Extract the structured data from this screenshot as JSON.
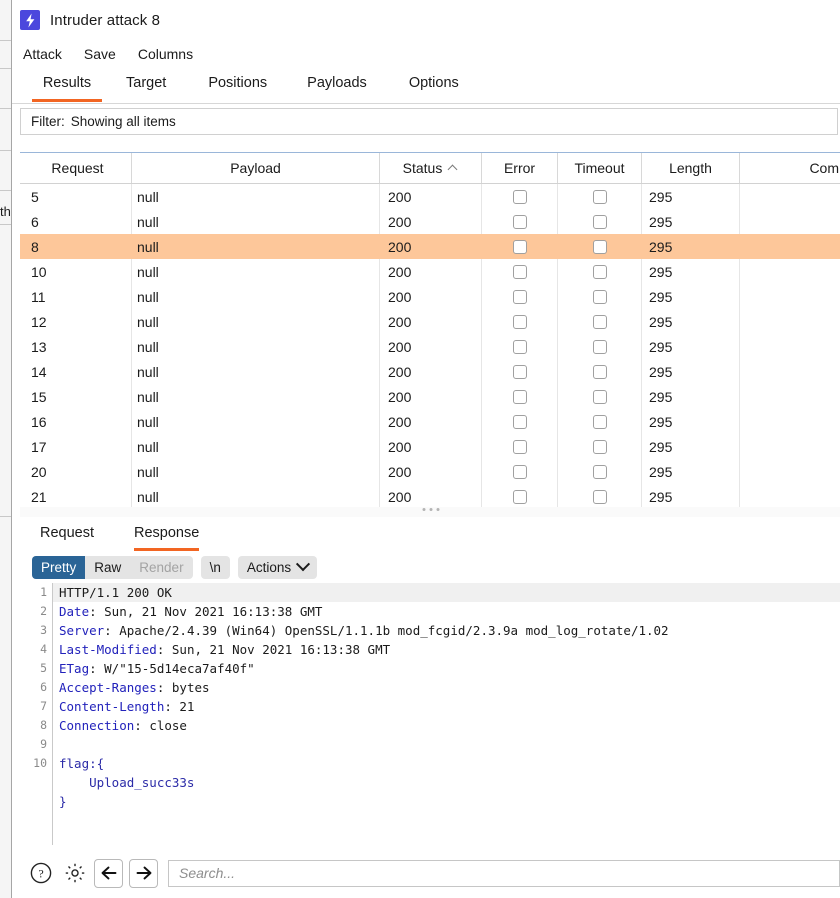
{
  "background_window": {
    "text_fragment": "th"
  },
  "window": {
    "title": "Intruder attack 8",
    "icon": "burp-lightning-icon"
  },
  "menubar": {
    "items": [
      "Attack",
      "Save",
      "Columns"
    ]
  },
  "tabs": {
    "items": [
      {
        "label": "Results",
        "active": true
      },
      {
        "label": "Target",
        "active": false
      },
      {
        "label": "Positions",
        "active": false
      },
      {
        "label": "Payloads",
        "active": false
      },
      {
        "label": "Options",
        "active": false
      }
    ]
  },
  "filter": {
    "label": "Filter:",
    "value": "Showing all items"
  },
  "results_table": {
    "columns": [
      {
        "key": "request",
        "label": "Request",
        "sort": ""
      },
      {
        "key": "payload",
        "label": "Payload",
        "sort": ""
      },
      {
        "key": "status",
        "label": "Status",
        "sort": "asc"
      },
      {
        "key": "error",
        "label": "Error",
        "sort": ""
      },
      {
        "key": "timeout",
        "label": "Timeout",
        "sort": ""
      },
      {
        "key": "length",
        "label": "Length",
        "sort": ""
      },
      {
        "key": "comment",
        "label": "Com",
        "sort": ""
      }
    ],
    "rows": [
      {
        "request": "5",
        "payload": "null",
        "status": "200",
        "error": false,
        "timeout": false,
        "length": "295",
        "comment": "",
        "selected": false
      },
      {
        "request": "6",
        "payload": "null",
        "status": "200",
        "error": false,
        "timeout": false,
        "length": "295",
        "comment": "",
        "selected": false
      },
      {
        "request": "8",
        "payload": "null",
        "status": "200",
        "error": false,
        "timeout": false,
        "length": "295",
        "comment": "",
        "selected": true
      },
      {
        "request": "10",
        "payload": "null",
        "status": "200",
        "error": false,
        "timeout": false,
        "length": "295",
        "comment": "",
        "selected": false
      },
      {
        "request": "11",
        "payload": "null",
        "status": "200",
        "error": false,
        "timeout": false,
        "length": "295",
        "comment": "",
        "selected": false
      },
      {
        "request": "12",
        "payload": "null",
        "status": "200",
        "error": false,
        "timeout": false,
        "length": "295",
        "comment": "",
        "selected": false
      },
      {
        "request": "13",
        "payload": "null",
        "status": "200",
        "error": false,
        "timeout": false,
        "length": "295",
        "comment": "",
        "selected": false
      },
      {
        "request": "14",
        "payload": "null",
        "status": "200",
        "error": false,
        "timeout": false,
        "length": "295",
        "comment": "",
        "selected": false
      },
      {
        "request": "15",
        "payload": "null",
        "status": "200",
        "error": false,
        "timeout": false,
        "length": "295",
        "comment": "",
        "selected": false
      },
      {
        "request": "16",
        "payload": "null",
        "status": "200",
        "error": false,
        "timeout": false,
        "length": "295",
        "comment": "",
        "selected": false
      },
      {
        "request": "17",
        "payload": "null",
        "status": "200",
        "error": false,
        "timeout": false,
        "length": "295",
        "comment": "",
        "selected": false
      },
      {
        "request": "20",
        "payload": "null",
        "status": "200",
        "error": false,
        "timeout": false,
        "length": "295",
        "comment": "",
        "selected": false
      },
      {
        "request": "21",
        "payload": "null",
        "status": "200",
        "error": false,
        "timeout": false,
        "length": "295",
        "comment": "",
        "selected": false
      }
    ]
  },
  "message_tabs": {
    "items": [
      {
        "label": "Request",
        "active": false
      },
      {
        "label": "Response",
        "active": true
      }
    ]
  },
  "viewbar": {
    "segments": [
      {
        "label": "Pretty",
        "state": "selected"
      },
      {
        "label": "Raw",
        "state": "normal"
      },
      {
        "label": "Render",
        "state": "disabled"
      }
    ],
    "newline_button": "\\n",
    "actions_button": "Actions"
  },
  "response": {
    "line_numbers": [
      "1",
      "2",
      "3",
      "4",
      "5",
      "6",
      "7",
      "8",
      "9",
      "10",
      "",
      "",
      ""
    ],
    "lines": [
      {
        "name": "",
        "sep": "",
        "value": "HTTP/1.1 200 OK",
        "kind": "statusline"
      },
      {
        "name": "Date",
        "sep": ": ",
        "value": "Sun, 21 Nov 2021 16:13:38 GMT",
        "kind": "header"
      },
      {
        "name": "Server",
        "sep": ": ",
        "value": "Apache/2.4.39 (Win64) OpenSSL/1.1.1b mod_fcgid/2.3.9a mod_log_rotate/1.02",
        "kind": "header"
      },
      {
        "name": "Last-Modified",
        "sep": ": ",
        "value": "Sun, 21 Nov 2021 16:13:38 GMT",
        "kind": "header"
      },
      {
        "name": "ETag",
        "sep": ": ",
        "value": "W/\"15-5d14eca7af40f\"",
        "kind": "header"
      },
      {
        "name": "Accept-Ranges",
        "sep": ": ",
        "value": "bytes",
        "kind": "header"
      },
      {
        "name": "Content-Length",
        "sep": ": ",
        "value": "21",
        "kind": "header"
      },
      {
        "name": "Connection",
        "sep": ": ",
        "value": "close",
        "kind": "header"
      },
      {
        "name": "",
        "sep": "",
        "value": "",
        "kind": "blank"
      },
      {
        "name": "",
        "sep": "",
        "value": "flag:{",
        "kind": "body"
      },
      {
        "name": "",
        "sep": "",
        "value": "    Upload_succ33s",
        "kind": "body"
      },
      {
        "name": "",
        "sep": "",
        "value": "}",
        "kind": "body"
      }
    ]
  },
  "footer": {
    "help_icon": "question-mark-icon",
    "settings_icon": "gear-icon",
    "back_icon": "arrow-left-icon",
    "forward_icon": "arrow-right-icon",
    "search_placeholder": "Search...",
    "search_value": ""
  },
  "colors": {
    "accent": "#f26522",
    "selection": "#fdc79a",
    "brand_icon": "#4b47dd",
    "segment_selected": "#2a6496",
    "header_name": "#2222bb"
  }
}
